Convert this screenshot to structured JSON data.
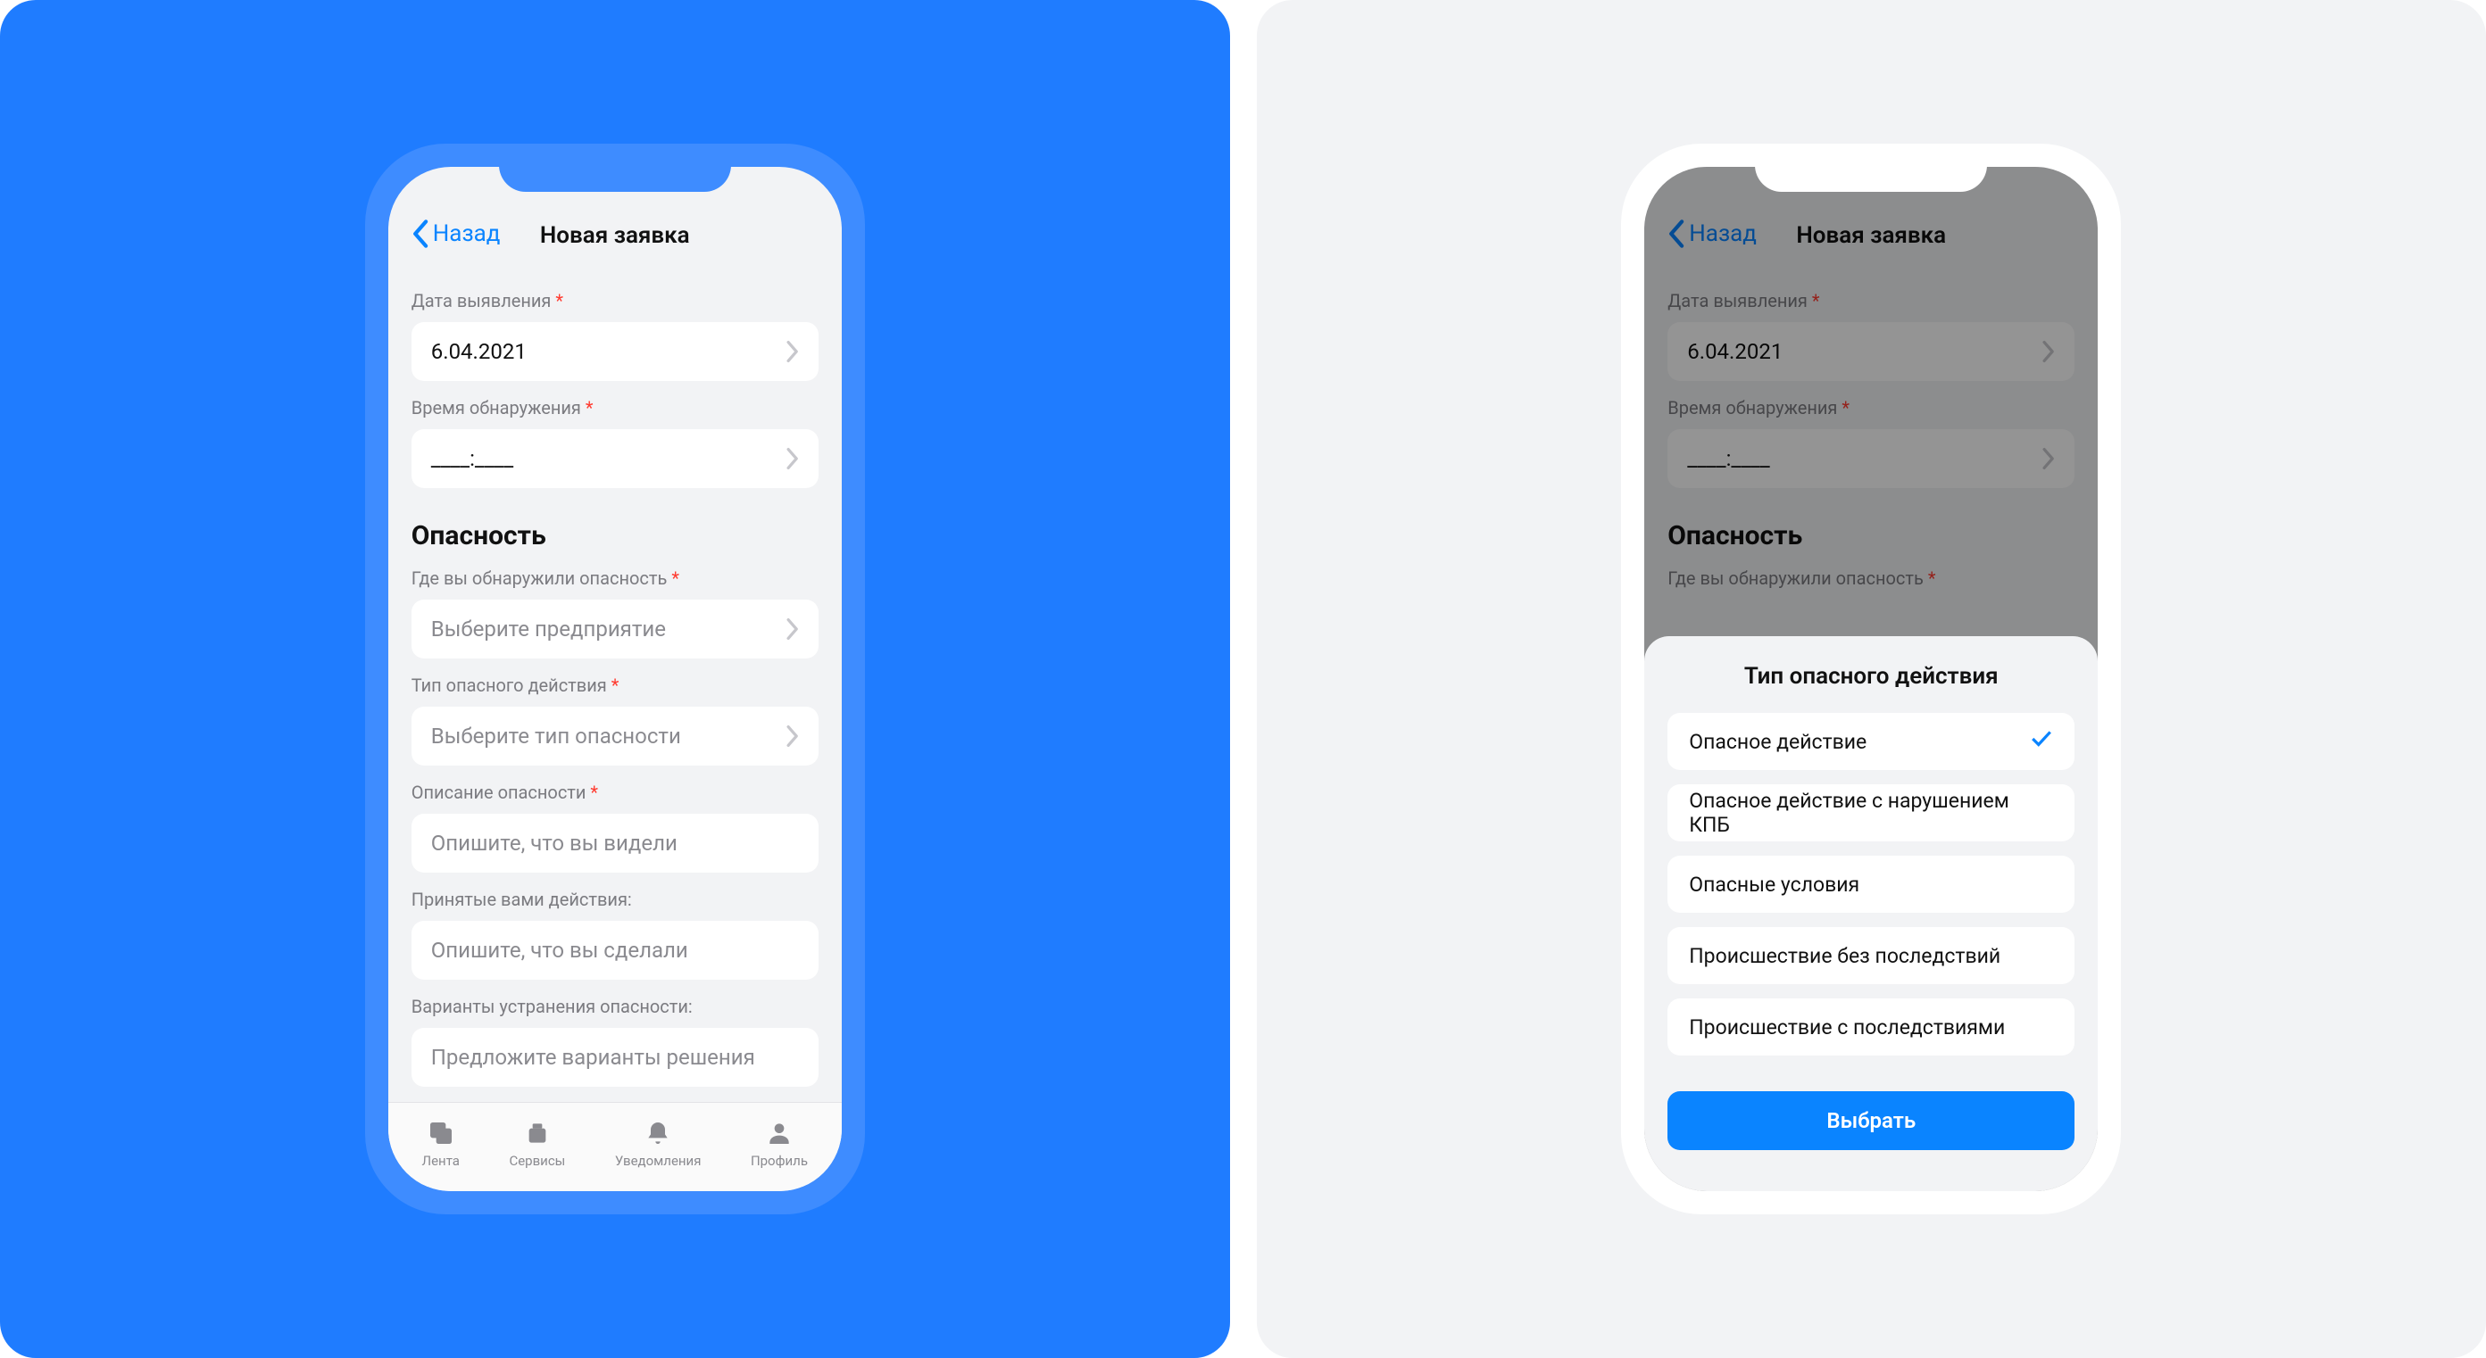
{
  "header": {
    "back": "Назад",
    "title": "Новая заявка"
  },
  "form": {
    "date_label": "Дата выявления",
    "date_value": "6.04.2021",
    "time_label": "Время обнаружения",
    "time_value": "____:____",
    "section": "Опасность",
    "where_label": "Где вы обнаружили опасность",
    "where_placeholder": "Выберите предприятие",
    "type_label": "Тип опасного действия",
    "type_placeholder": "Выберите тип опасности",
    "desc_label": "Описание опасности",
    "desc_placeholder": "Опишите, что вы видели",
    "actions_label": "Принятые вами действия:",
    "actions_placeholder": "Опишите, что вы сделали",
    "variants_label": "Варианты устранения опасности:",
    "variants_placeholder": "Предложите варианты решения"
  },
  "tabs": {
    "feed": "Лента",
    "services": "Сервисы",
    "notifications": "Уведомления",
    "profile": "Профиль"
  },
  "sheet": {
    "title": "Тип опасного действия",
    "opt0": "Опасное действие",
    "opt1": "Опасное действие с нарушением КПБ",
    "opt2": "Опасные условия",
    "opt3": "Происшествие без последствий",
    "opt4": "Происшествие с последствиями",
    "button": "Выбрать"
  },
  "asterisk": "*"
}
